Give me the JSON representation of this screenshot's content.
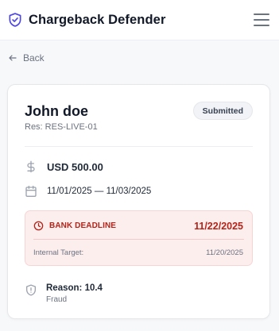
{
  "header": {
    "title": "Chargeback Defender",
    "brand_icon": "shield-check-icon",
    "menu_icon": "hamburger-menu-icon"
  },
  "nav": {
    "back_label": "Back"
  },
  "case": {
    "customer_name": "John doe",
    "reservation": "Res: RES-LIVE-01",
    "status": "Submitted",
    "amount": "USD 500.00",
    "dates": "11/01/2025 — 11/03/2025",
    "deadline": {
      "label": "BANK DEADLINE",
      "date": "11/22/2025",
      "internal_label": "Internal Target:",
      "internal_date": "11/20/2025"
    },
    "reason": {
      "title": "Reason: 10.4",
      "subtitle": "Fraud"
    }
  },
  "colors": {
    "brand": "#4f46e5",
    "danger": "#b42318",
    "danger_bg": "#fdeeee"
  }
}
